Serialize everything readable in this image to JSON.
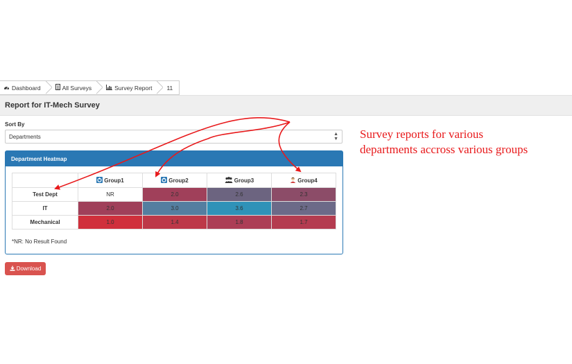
{
  "breadcrumb": {
    "items": [
      {
        "label": "Dashboard",
        "icon": "dashboard-icon"
      },
      {
        "label": "All Surveys",
        "icon": "document-icon"
      },
      {
        "label": "Survey Report",
        "icon": "bar-chart-icon"
      },
      {
        "label": "11"
      }
    ]
  },
  "page": {
    "title": "Report for IT-Mech Survey",
    "sort_label": "Sort By",
    "sort_value": "Departments"
  },
  "panel": {
    "title": "Department Heatmap",
    "columns": [
      {
        "label": "Group1",
        "icon": "group-icon-blue"
      },
      {
        "label": "Group2",
        "icon": "group-icon-blue"
      },
      {
        "label": "Group3",
        "icon": "people-icon"
      },
      {
        "label": "Group4",
        "icon": "person-icon"
      }
    ],
    "rows": [
      {
        "label": "Test Dept",
        "cells": [
          {
            "value": "NR",
            "color": "#ffffff"
          },
          {
            "value": "2.0",
            "color": "#a0405a"
          },
          {
            "value": "2.6",
            "color": "#6c6480"
          },
          {
            "value": "2.3",
            "color": "#8c4c68"
          }
        ]
      },
      {
        "label": "IT",
        "cells": [
          {
            "value": "2.0",
            "color": "#a0405a"
          },
          {
            "value": "3.0",
            "color": "#547ea0"
          },
          {
            "value": "3.6",
            "color": "#2f92b8"
          },
          {
            "value": "2.7",
            "color": "#6c6a88"
          }
        ]
      },
      {
        "label": "Mechanical",
        "cells": [
          {
            "value": "1.0",
            "color": "#d0303c"
          },
          {
            "value": "1.4",
            "color": "#bd3848"
          },
          {
            "value": "1.8",
            "color": "#ac3e56"
          },
          {
            "value": "1.7",
            "color": "#b43c50"
          }
        ]
      }
    ],
    "note": "*NR: No Result Found"
  },
  "download_label": "Download",
  "annotation": {
    "line1": "Survey reports for various",
    "line2": "departments accross various groups",
    "color": "#e8191b"
  }
}
